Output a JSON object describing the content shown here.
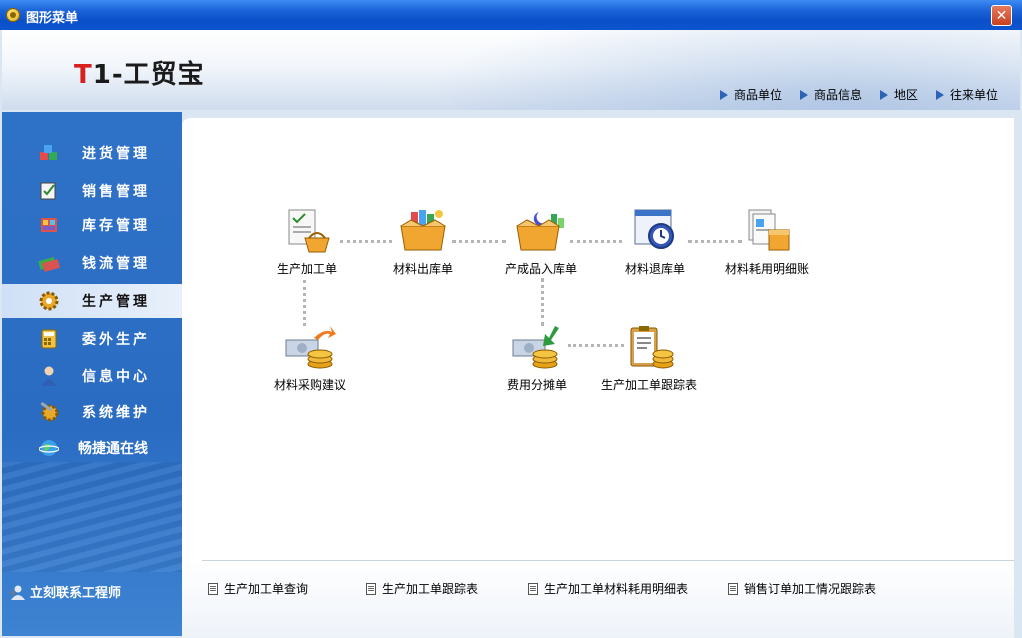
{
  "window": {
    "title": "图形菜单",
    "close_glyph": "✕"
  },
  "header": {
    "logo_prefix": "T",
    "logo_rest": "1-工贸宝",
    "links": [
      {
        "label": "商品单位"
      },
      {
        "label": "商品信息"
      },
      {
        "label": "地区"
      },
      {
        "label": "往来单位"
      }
    ]
  },
  "sidebar": {
    "items": [
      {
        "label": "进货管理",
        "icon": "purchase-icon"
      },
      {
        "label": "销售管理",
        "icon": "sales-icon"
      },
      {
        "label": "库存管理",
        "icon": "inventory-icon"
      },
      {
        "label": "钱流管理",
        "icon": "cashflow-icon"
      },
      {
        "label": "生产管理",
        "icon": "production-gear-icon",
        "active": true
      },
      {
        "label": "委外生产",
        "icon": "calculator-icon"
      },
      {
        "label": "信息中心",
        "icon": "person-icon"
      },
      {
        "label": "系统维护",
        "icon": "maintenance-icon"
      },
      {
        "label": "畅捷通在线",
        "icon": "globe-icon"
      }
    ],
    "contact_label": "立刻联系工程师"
  },
  "flow": {
    "nodes": [
      {
        "label": "生产加工单"
      },
      {
        "label": "材料出库单"
      },
      {
        "label": "产成品入库单"
      },
      {
        "label": "材料退库单"
      },
      {
        "label": "材料耗用明细账"
      },
      {
        "label": "材料采购建议"
      },
      {
        "label": "费用分摊单"
      },
      {
        "label": "生产加工单跟踪表"
      }
    ]
  },
  "bottom_links": [
    {
      "label": "生产加工单查询"
    },
    {
      "label": "生产加工单跟踪表"
    },
    {
      "label": "生产加工单材料耗用明细表"
    },
    {
      "label": "销售订单加工情况跟踪表"
    }
  ],
  "colors": {
    "accent": "#2a6cc2",
    "logo_red": "#d7211f",
    "titlebar": "#0a4fc9"
  }
}
